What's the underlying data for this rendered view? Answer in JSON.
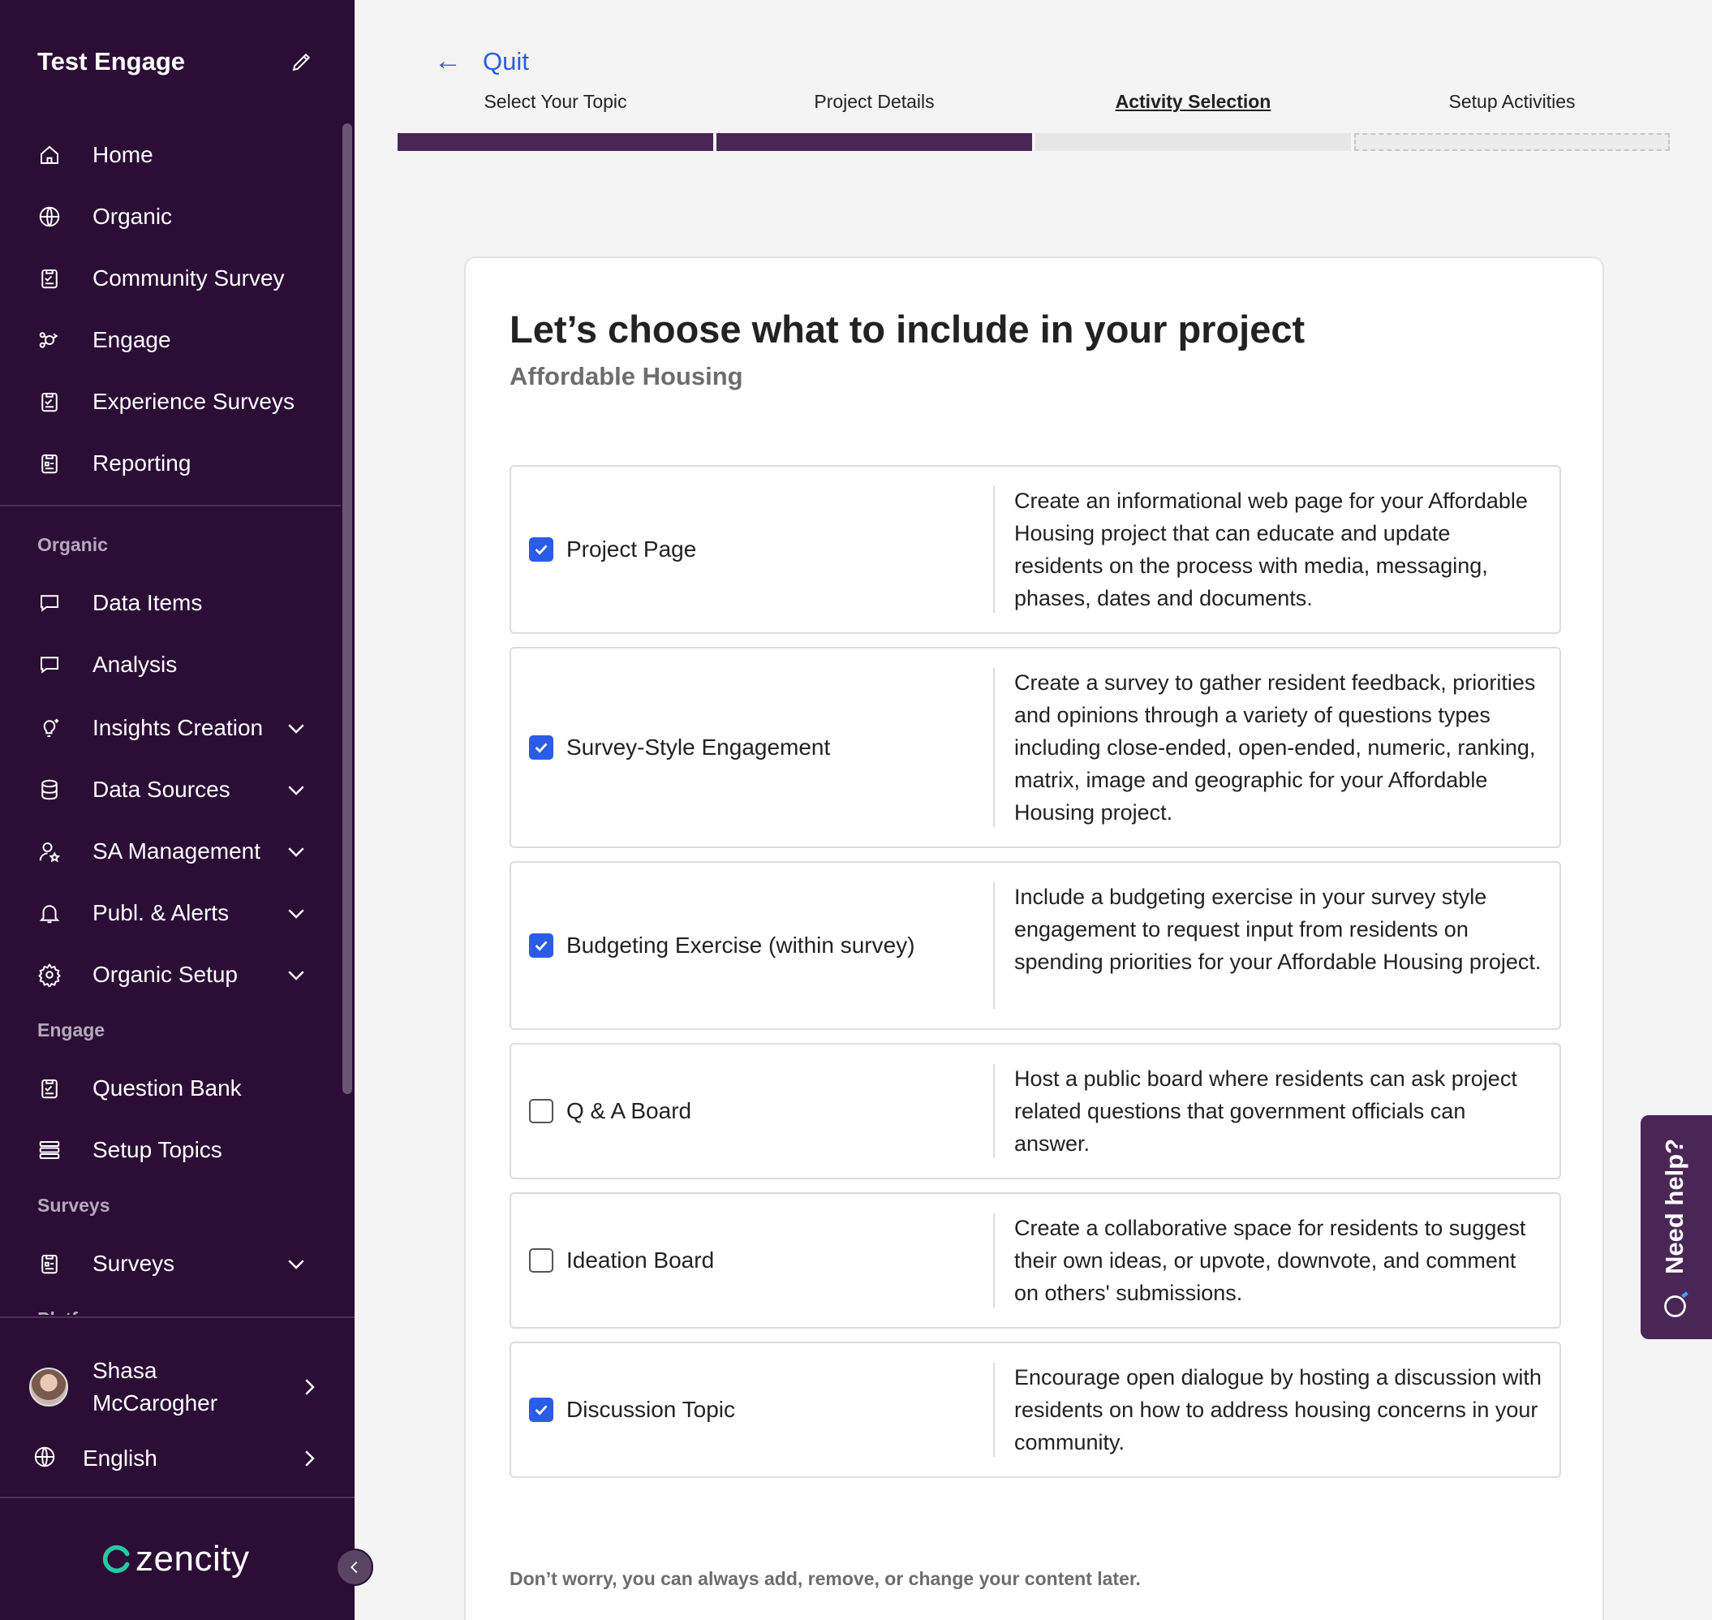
{
  "sidebar": {
    "title": "Test Engage",
    "nav": [
      {
        "label": "Home",
        "icon": "home-icon"
      },
      {
        "label": "Organic",
        "icon": "globe-icon"
      },
      {
        "label": "Community Survey",
        "icon": "clipboard-icon"
      },
      {
        "label": "Engage",
        "icon": "engage-icon"
      },
      {
        "label": "Experience Surveys",
        "icon": "clipboard-icon"
      },
      {
        "label": "Reporting",
        "icon": "report-icon"
      }
    ],
    "sections": {
      "organic": "Organic",
      "engage": "Engage",
      "surveys": "Surveys",
      "platform": "Platform"
    },
    "organic_items": [
      {
        "label": "Data Items",
        "icon": "chat-icon"
      },
      {
        "label": "Analysis",
        "icon": "chat-icon"
      },
      {
        "label": "Insights Creation",
        "icon": "lightbulb-icon"
      },
      {
        "label": "Data Sources",
        "icon": "database-icon"
      },
      {
        "label": "SA Management",
        "icon": "user-star-icon"
      },
      {
        "label": "Publ. & Alerts",
        "icon": "bell-icon"
      },
      {
        "label": "Organic Setup",
        "icon": "gear-icon"
      }
    ],
    "engage_items": [
      {
        "label": "Question Bank",
        "icon": "clipboard-icon"
      },
      {
        "label": "Setup Topics",
        "icon": "list-icon"
      }
    ],
    "survey_items": [
      {
        "label": "Surveys",
        "icon": "report-icon"
      }
    ],
    "user_name": "Shasa McCarogher",
    "language": "English",
    "logo": "zencity"
  },
  "header": {
    "quit_label": "Quit",
    "steps": [
      {
        "label": "Select Your Topic",
        "state": "done"
      },
      {
        "label": "Project Details",
        "state": "done"
      },
      {
        "label": "Activity Selection",
        "state": "active"
      },
      {
        "label": "Setup Activities",
        "state": "next"
      }
    ]
  },
  "content": {
    "title": "Let’s choose what to include in your project",
    "subtitle": "Affordable Housing",
    "options": [
      {
        "name": "Project Page",
        "checked": true,
        "description": "Create an informational web page for your Affordable Housing project that can educate and update residents on the process with media, messaging, phases, dates and documents."
      },
      {
        "name": "Survey-Style Engagement",
        "checked": true,
        "description": "Create a survey to gather resident feedback, priorities and opinions through a variety of questions types including close-ended, open-ended, numeric, ranking, matrix, image and geographic for your Affordable Housing project."
      },
      {
        "name": "Budgeting Exercise (within survey)",
        "checked": true,
        "description": "Include a budgeting exercise in your survey style engagement to request input from residents on spending priorities for your Affordable Housing project."
      },
      {
        "name": "Q & A Board",
        "checked": false,
        "description": "Host a public board where residents can ask project related questions that government officials can answer."
      },
      {
        "name": "Ideation Board",
        "checked": false,
        "description": "Create a collaborative space for residents to suggest their own ideas, or upvote, downvote, and comment on others' submissions."
      },
      {
        "name": "Discussion Topic",
        "checked": true,
        "description": "Encourage open dialogue by hosting a discussion with residents on how to address housing concerns in your community."
      }
    ],
    "footnote": "Don’t worry, you can always add, remove, or change your content later."
  },
  "help": {
    "label": "Need help?"
  },
  "colors": {
    "sidebar_bg": "#2b0d36",
    "accent": "#2b5ce6",
    "progress": "#4a2656"
  }
}
